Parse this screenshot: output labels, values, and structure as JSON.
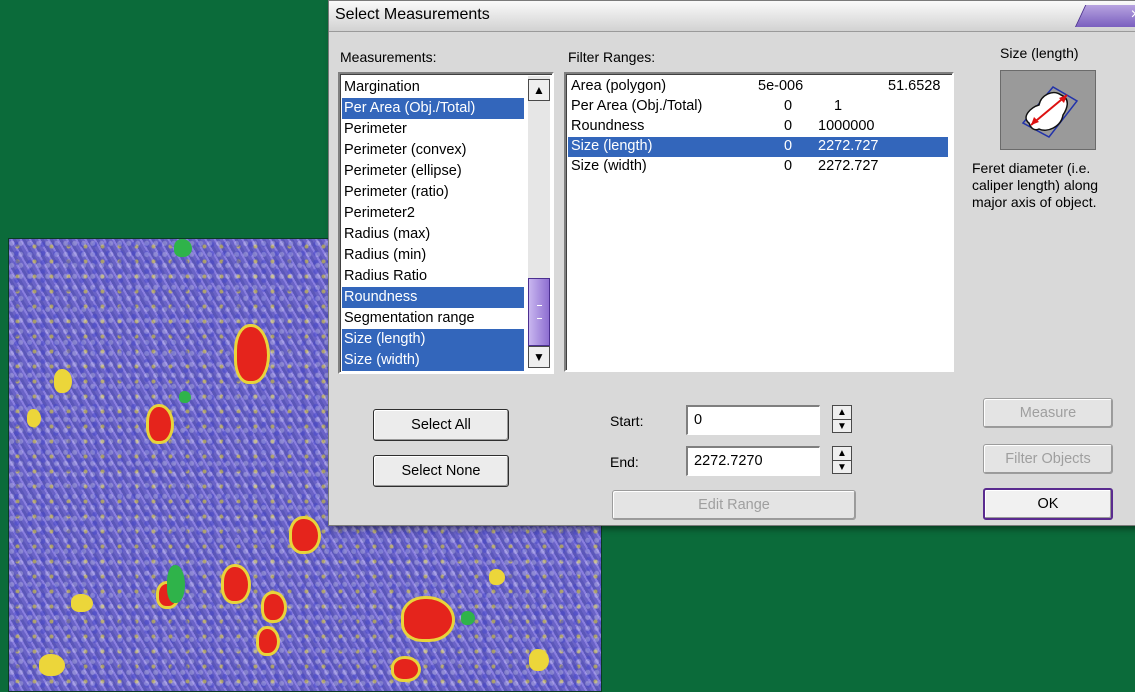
{
  "dialog": {
    "title": "Select Measurements",
    "close_glyph": "×",
    "measurements_label": "Measurements:",
    "filter_ranges_label": "Filter Ranges:",
    "measurements": [
      {
        "label": "Margination",
        "selected": false
      },
      {
        "label": "Per Area (Obj./Total)",
        "selected": true
      },
      {
        "label": "Perimeter",
        "selected": false
      },
      {
        "label": "Perimeter (convex)",
        "selected": false
      },
      {
        "label": "Perimeter (ellipse)",
        "selected": false
      },
      {
        "label": "Perimeter (ratio)",
        "selected": false
      },
      {
        "label": "Perimeter2",
        "selected": false
      },
      {
        "label": "Radius (max)",
        "selected": false
      },
      {
        "label": "Radius (min)",
        "selected": false
      },
      {
        "label": "Radius Ratio",
        "selected": false
      },
      {
        "label": "Roundness",
        "selected": true
      },
      {
        "label": "Segmentation range",
        "selected": false
      },
      {
        "label": "Size (length)",
        "selected": true
      },
      {
        "label": "Size (width)",
        "selected": true
      }
    ],
    "filter_ranges": [
      {
        "name": "Area (polygon)",
        "min": "5e-006",
        "max": "51.6528",
        "selected": false
      },
      {
        "name": "Per Area (Obj./Total)",
        "min": "0",
        "max": "1",
        "selected": false
      },
      {
        "name": "Roundness",
        "min": "0",
        "max": "1000000",
        "selected": false
      },
      {
        "name": "Size (length)",
        "min": "0",
        "max": "2272.727",
        "selected": true
      },
      {
        "name": "Size (width)",
        "min": "0",
        "max": "2272.727",
        "selected": false
      }
    ],
    "preview": {
      "title": "Size (length)",
      "description": "Feret diameter (i.e. caliper length) along major axis of object.",
      "icon": "feret-diameter-icon"
    },
    "buttons": {
      "select_all": "Select All",
      "select_none": "Select None",
      "edit_range": "Edit Range",
      "measure": "Measure",
      "filter_objects": "Filter Objects",
      "ok": "OK"
    },
    "start_label": "Start:",
    "start_value": "0",
    "end_label": "End:",
    "end_value": "2272.7270",
    "spin_up": "▲",
    "spin_down": "▼",
    "scroll_up": "▲",
    "scroll_down": "▼"
  },
  "colors": {
    "background": "#0b6b3a",
    "selection": "#3366bb",
    "accent_purple": "#7a5fbf"
  }
}
